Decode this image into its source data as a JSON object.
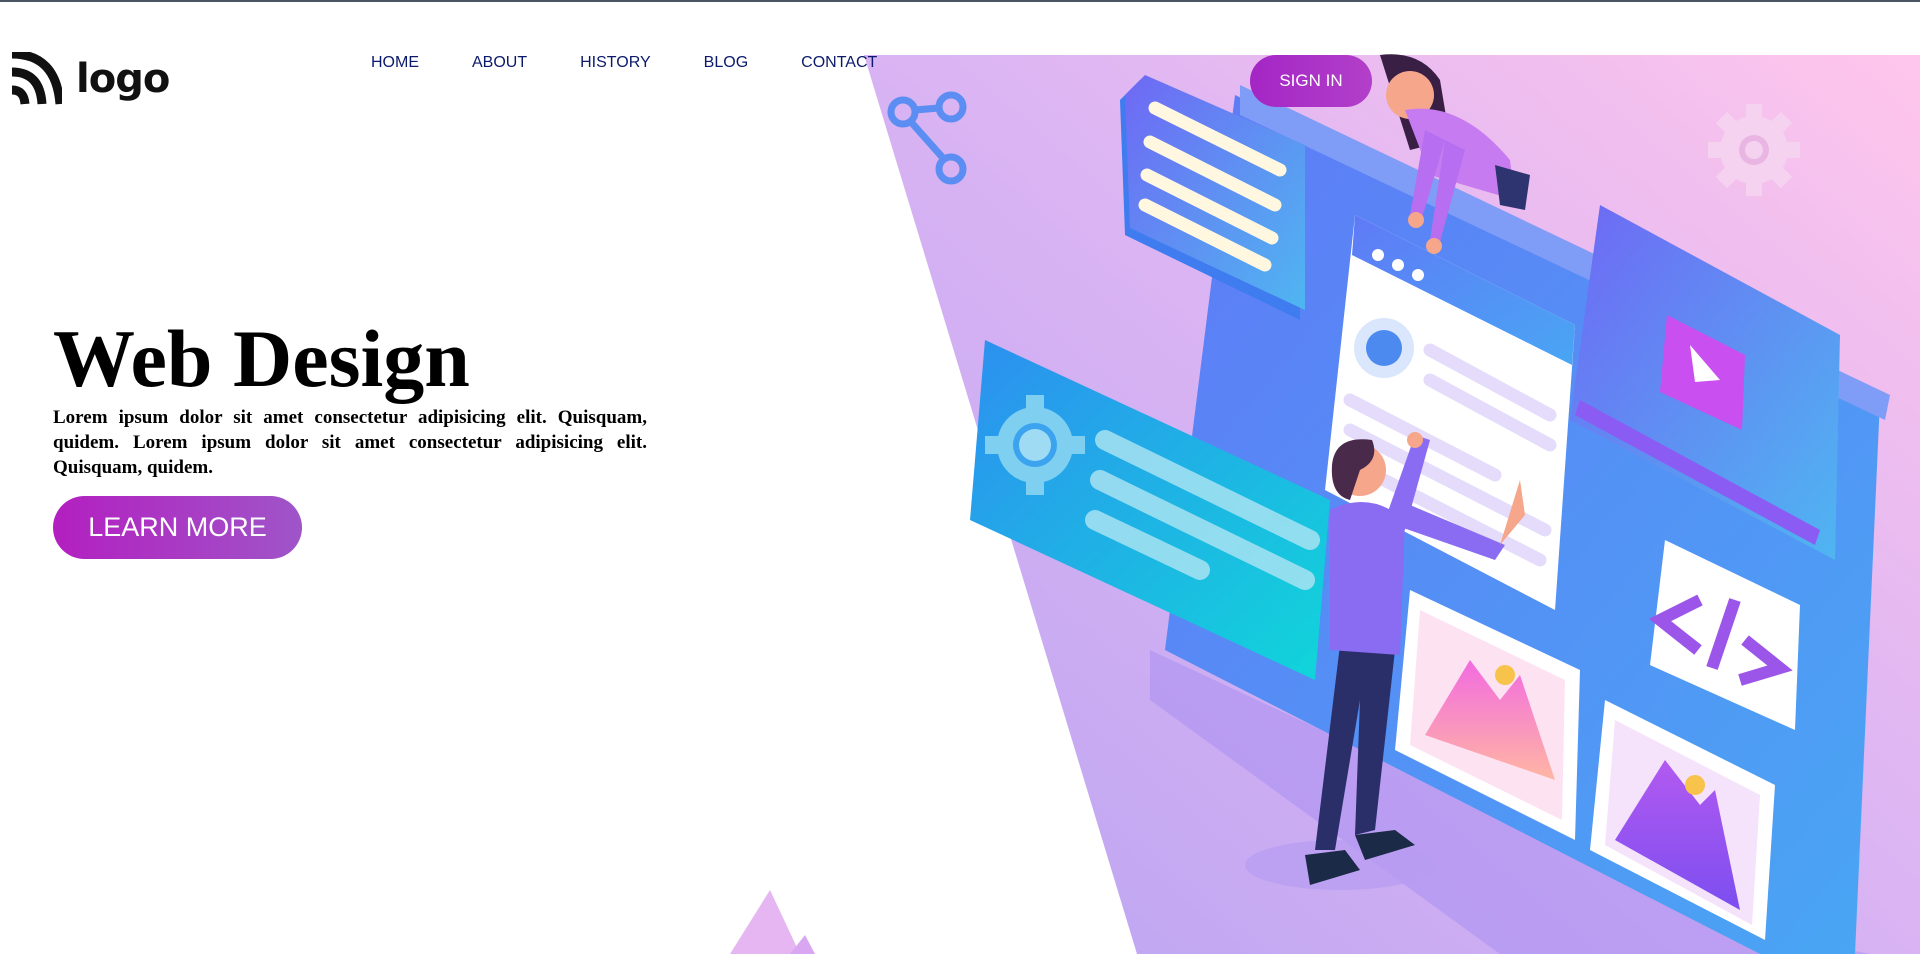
{
  "brand": {
    "logo_text": "logo"
  },
  "nav": {
    "items": [
      {
        "label": "HOME"
      },
      {
        "label": "ABOUT"
      },
      {
        "label": "HISTORY"
      },
      {
        "label": "BLOG"
      },
      {
        "label": "CONTACT"
      }
    ],
    "signin_label": "SIGN IN"
  },
  "hero": {
    "title": "Web Design",
    "description": "Lorem ipsum dolor sit amet consectetur adipisicing elit. Quisquam, quidem. Lorem ipsum dolor sit amet consectetur adipisicing elit. Quisquam, quidem.",
    "cta_label": "LEARN MORE"
  },
  "colors": {
    "accent": "#a426c5",
    "nav_text": "#0b1a6b",
    "panel_purple": "#c9a6f0",
    "panel_pink": "#f9c5ec"
  },
  "icons": [
    "logo-mark-icon",
    "share-icon",
    "gear-icon",
    "code-icon",
    "image-icon",
    "play-icon"
  ]
}
